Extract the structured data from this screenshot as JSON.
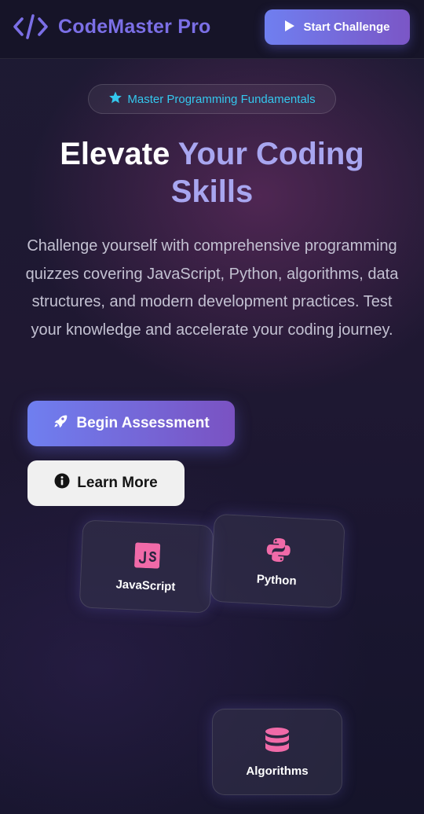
{
  "header": {
    "brand": "CodeMaster Pro",
    "start_button_label": "Start Challenge"
  },
  "hero": {
    "badge_text": "Master Programming Fundamentals",
    "headline_part1": "Elevate",
    "headline_part2": "Your Coding Skills",
    "description": "Challenge yourself with comprehensive programming quizzes covering JavaScript, Python, algorithms, data structures, and modern development practices. Test your knowledge and accelerate your coding journey.",
    "primary_button_label": "Begin Assessment",
    "secondary_button_label": "Learn More"
  },
  "topics": [
    {
      "label": "JavaScript",
      "icon": "javascript-icon"
    },
    {
      "label": "Python",
      "icon": "python-icon"
    },
    {
      "label": "Algorithms",
      "icon": "database-icon"
    }
  ],
  "colors": {
    "brand": "#7b6fe6",
    "accent_gradient_start": "#6f7ff0",
    "accent_gradient_end": "#7b56c6",
    "badge_text": "#34c8ee",
    "topic_icon": "#f06aa8"
  }
}
